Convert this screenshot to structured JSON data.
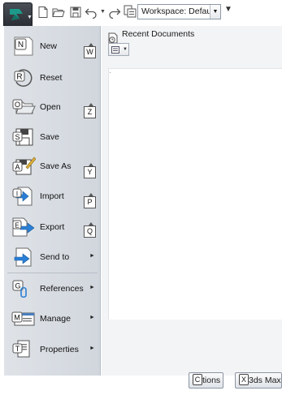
{
  "qat": {
    "workspace_label": "Workspace: Default"
  },
  "menu": {
    "items": [
      {
        "label": "New",
        "keytip": "W",
        "icon": "new-icon",
        "icon_key": "N"
      },
      {
        "label": "Reset",
        "icon": "reset-icon",
        "icon_key": "R"
      },
      {
        "label": "Open",
        "keytip": "Z",
        "icon": "open-icon",
        "icon_key": "O"
      },
      {
        "label": "Save",
        "icon": "save-icon",
        "icon_key": "S"
      },
      {
        "label": "Save As",
        "keytip": "Y",
        "icon": "save-as-icon",
        "icon_key": "A"
      },
      {
        "label": "Import",
        "keytip": "P",
        "icon": "import-icon",
        "icon_key": "I"
      },
      {
        "label": "Export",
        "keytip": "Q",
        "icon": "export-icon",
        "icon_key": "E"
      },
      {
        "label": "Send to",
        "icon": "send-to-icon",
        "has_submenu": true
      },
      {
        "label": "References",
        "icon": "references-icon",
        "icon_key": "G",
        "has_submenu": true
      },
      {
        "label": "Manage",
        "icon": "manage-icon",
        "icon_key": "M",
        "has_submenu": true
      },
      {
        "label": "Properties",
        "icon": "properties-icon",
        "icon_key": "T",
        "has_submenu": true
      }
    ]
  },
  "recent": {
    "title": "Recent Documents"
  },
  "bottom": {
    "options_keytip": "C",
    "options_label": "tions",
    "exit_keytip": "X",
    "exit_label": "3ds Max"
  },
  "colors": {
    "app_button": "#2f3238",
    "logo_teal": "#1e9a8a",
    "pane_bg": "#d8dde3",
    "arrow_blue": "#2a7fd6"
  }
}
